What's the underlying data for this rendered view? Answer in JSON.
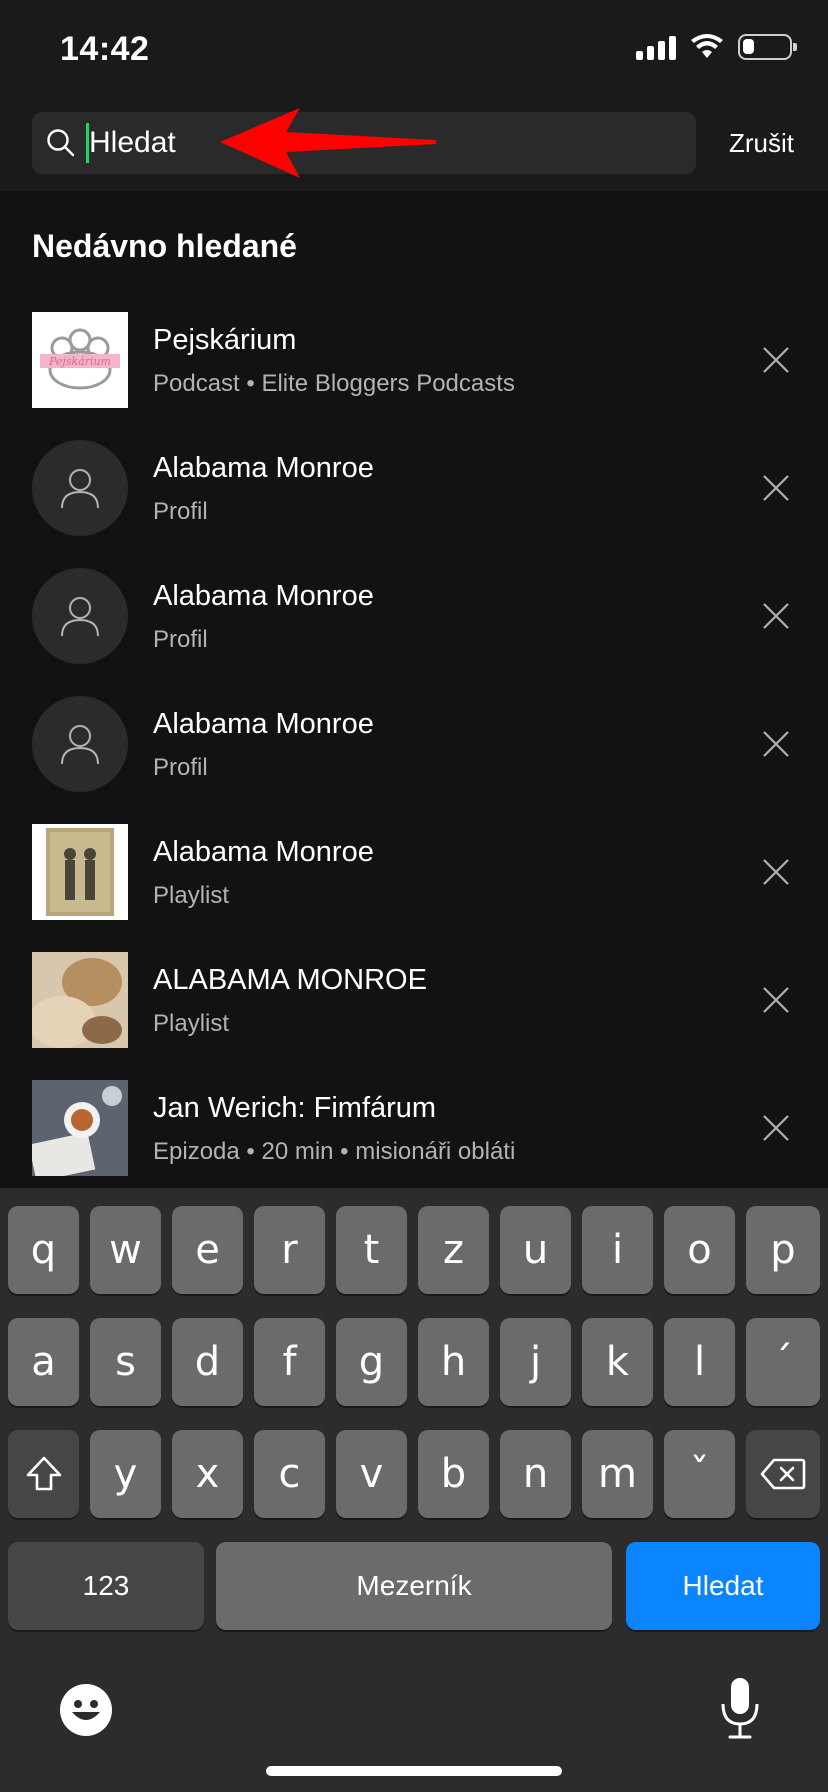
{
  "status_bar": {
    "time": "14:42",
    "battery_level": 0.25
  },
  "search": {
    "placeholder": "Hledat",
    "cancel_label": "Zrušit"
  },
  "recent": {
    "title": "Nedávno hledané",
    "items": [
      {
        "title": "Pejskárium",
        "subtitle": "Podcast • Elite Bloggers Podcasts",
        "thumb": "podcast-art"
      },
      {
        "title": "Alabama Monroe",
        "subtitle": "Profil",
        "thumb": "user-icon"
      },
      {
        "title": "Alabama Monroe",
        "subtitle": "Profil",
        "thumb": "user-icon"
      },
      {
        "title": "Alabama Monroe",
        "subtitle": "Profil",
        "thumb": "user-icon"
      },
      {
        "title": "Alabama Monroe",
        "subtitle": "Playlist",
        "thumb": "playlist-art"
      },
      {
        "title": "ALABAMA MONROE",
        "subtitle": "Playlist",
        "thumb": "playlist-art"
      },
      {
        "title": "Jan Werich: Fimfárum",
        "subtitle": "Epizoda • 20 min • misionáři obláti",
        "thumb": "episode-art"
      }
    ]
  },
  "keyboard": {
    "row1": [
      "q",
      "w",
      "e",
      "r",
      "t",
      "z",
      "u",
      "i",
      "o",
      "p"
    ],
    "row2": [
      "a",
      "s",
      "d",
      "f",
      "g",
      "h",
      "j",
      "k",
      "l",
      "´"
    ],
    "row3": [
      "y",
      "x",
      "c",
      "v",
      "b",
      "n",
      "m",
      "ˇ"
    ],
    "numbers_label": "123",
    "space_label": "Mezerník",
    "search_label": "Hledat"
  },
  "colors": {
    "accent_caret": "#1ed760",
    "keyboard_search": "#0a84ff",
    "annotation_arrow": "#ff0000"
  }
}
